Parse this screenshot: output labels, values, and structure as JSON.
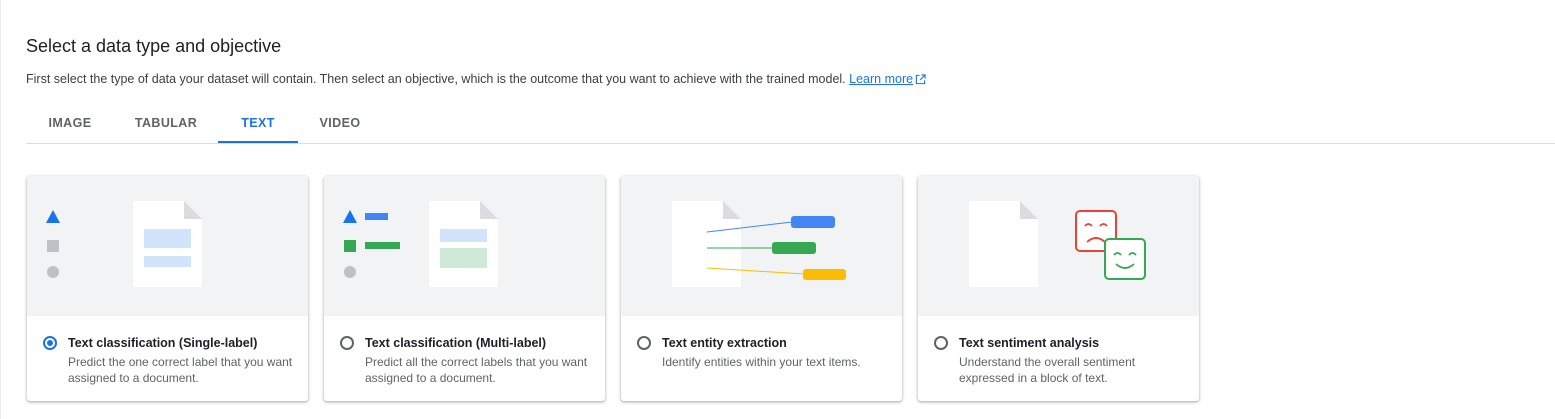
{
  "header": {
    "title": "Select a data type and objective",
    "subtitle": "First select the type of data your dataset will contain. Then select an objective, which is the outcome that you want to achieve with the trained model.",
    "learn_more": "Learn more"
  },
  "tabs": [
    {
      "label": "IMAGE",
      "active": false
    },
    {
      "label": "TABULAR",
      "active": false
    },
    {
      "label": "TEXT",
      "active": true
    },
    {
      "label": "VIDEO",
      "active": false
    }
  ],
  "objectives": [
    {
      "title": "Text classification (Single-label)",
      "description": "Predict the one correct label that you want assigned to a document.",
      "selected": true,
      "icon": "single-label-illustration"
    },
    {
      "title": "Text classification (Multi-label)",
      "description": "Predict all the correct labels that you want assigned to a document.",
      "selected": false,
      "icon": "multi-label-illustration"
    },
    {
      "title": "Text entity extraction",
      "description": "Identify entities within your text items.",
      "selected": false,
      "icon": "entity-extraction-illustration"
    },
    {
      "title": "Text sentiment analysis",
      "description": "Understand the overall sentiment expressed in a block of text.",
      "selected": false,
      "icon": "sentiment-illustration"
    }
  ],
  "colors": {
    "accent": "#1a73e8",
    "blue": "#4285f4",
    "green": "#34a853",
    "yellow": "#fbbc04",
    "red": "#ea4335"
  }
}
